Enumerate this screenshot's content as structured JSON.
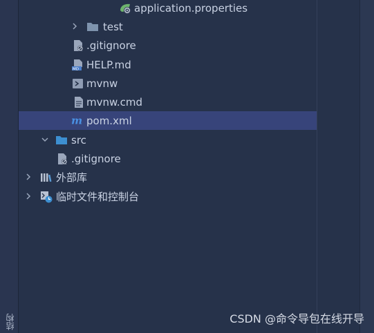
{
  "side_tab": "结构",
  "tree": {
    "items": [
      {
        "label": "application.properties",
        "icon": "spring-properties-icon"
      },
      {
        "label": "test",
        "icon": "folder-icon"
      },
      {
        "label": ".gitignore",
        "icon": "ignore-file-icon"
      },
      {
        "label": "HELP.md",
        "icon": "markdown-file-icon"
      },
      {
        "label": "mvnw",
        "icon": "shell-script-icon"
      },
      {
        "label": "mvnw.cmd",
        "icon": "text-file-icon"
      },
      {
        "label": "pom.xml",
        "icon": "maven-icon"
      },
      {
        "label": "src",
        "icon": "folder-icon"
      },
      {
        "label": ".gitignore",
        "icon": "ignore-file-icon"
      },
      {
        "label": "外部库",
        "icon": "library-icon"
      },
      {
        "label": "临时文件和控制台",
        "icon": "scratches-icon"
      }
    ]
  },
  "watermark": "CSDN @命令导包在线开导",
  "colors": {
    "background": "#26324a",
    "selection": "#37447a",
    "folder": "#7e93ad",
    "src_folder": "#3d8fd1",
    "maven": "#4a90e2"
  }
}
